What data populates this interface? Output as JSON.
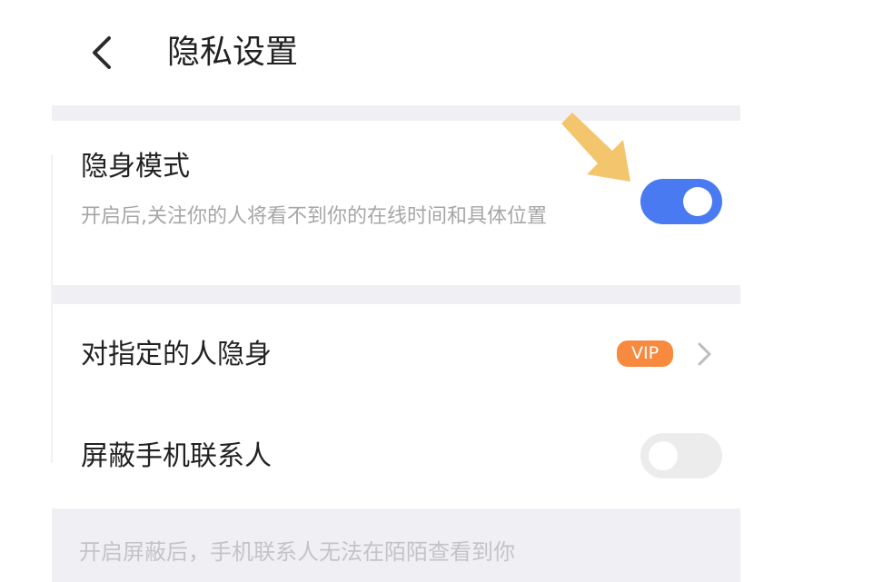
{
  "header": {
    "back_icon": "chevron-left-icon",
    "title": "隐私设置"
  },
  "invisible_mode": {
    "title": "隐身模式",
    "description": "开启后,关注你的人将看不到你的在线时间和具体位置",
    "enabled": true
  },
  "invisible_to_specific": {
    "title": "对指定的人隐身",
    "badge": "VIP",
    "arrow_icon": "chevron-right-icon"
  },
  "block_contacts": {
    "title": "屏蔽手机联系人",
    "enabled": false
  },
  "footer": {
    "note": "开启屏蔽后，手机联系人无法在陌陌查看到你"
  },
  "colors": {
    "toggle_on": "#4a7af2",
    "toggle_off": "#ececec",
    "vip_badge": "#f88a3f",
    "section_gap": "#f0eff4",
    "annotation_arrow": "#f3c56d"
  }
}
